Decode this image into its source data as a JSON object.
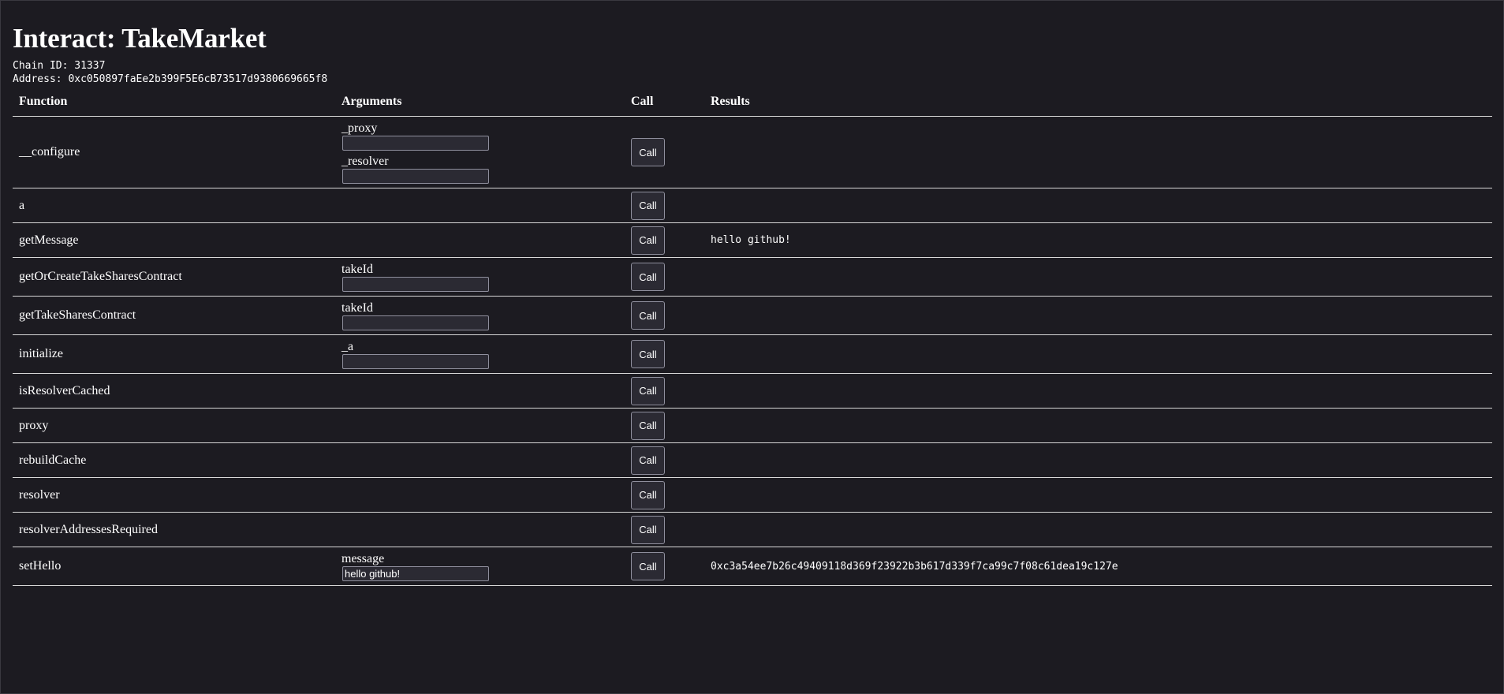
{
  "header": {
    "title": "Interact: TakeMarket",
    "chain_id_label": "Chain ID: 31337",
    "address_label": "Address: 0xc050897faEe2b399F5E6cB73517d9380669665f8"
  },
  "table": {
    "columns": [
      "Function",
      "Arguments",
      "Call",
      "Results"
    ],
    "call_label": "Call",
    "rows": [
      {
        "name": "__configure",
        "args": [
          {
            "label": "_proxy",
            "value": ""
          },
          {
            "label": "_resolver",
            "value": ""
          }
        ],
        "result": ""
      },
      {
        "name": "a",
        "args": [],
        "result": ""
      },
      {
        "name": "getMessage",
        "args": [],
        "result": "hello github!"
      },
      {
        "name": "getOrCreateTakeSharesContract",
        "args": [
          {
            "label": "takeId",
            "value": ""
          }
        ],
        "result": ""
      },
      {
        "name": "getTakeSharesContract",
        "args": [
          {
            "label": "takeId",
            "value": ""
          }
        ],
        "result": ""
      },
      {
        "name": "initialize",
        "args": [
          {
            "label": "_a",
            "value": ""
          }
        ],
        "result": ""
      },
      {
        "name": "isResolverCached",
        "args": [],
        "result": ""
      },
      {
        "name": "proxy",
        "args": [],
        "result": ""
      },
      {
        "name": "rebuildCache",
        "args": [],
        "result": ""
      },
      {
        "name": "resolver",
        "args": [],
        "result": ""
      },
      {
        "name": "resolverAddressesRequired",
        "args": [],
        "result": ""
      },
      {
        "name": "setHello",
        "args": [
          {
            "label": "message",
            "value": "hello github!"
          }
        ],
        "result": "0xc3a54ee7b26c49409118d369f23922b3b617d339f7ca99c7f08c61dea19c127e"
      }
    ]
  }
}
